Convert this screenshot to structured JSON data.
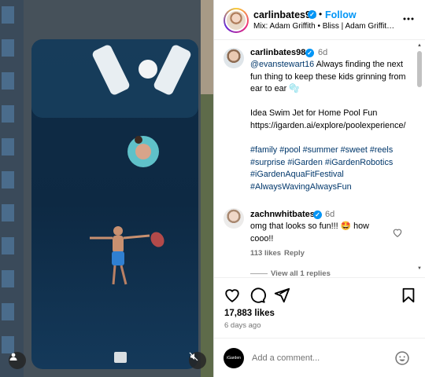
{
  "post": {
    "username": "carlinbates98",
    "follow_label": "Follow",
    "separator": "•",
    "audio": "Mix: Adam Griffith • Bliss | Adam Griffith ..."
  },
  "caption": {
    "username": "carlinbates98",
    "time": "6d",
    "mention": "@evanstewart16",
    "text_line1": " Always finding the next fun thing to keep these kids grinning from ear to ear 🫧",
    "text_line2": "Idea Swim Jet for Home Pool Fun",
    "link": "https://igarden.ai/explore/poolexperience/",
    "hashtags": "#family #pool #summer #sweet #reels #surprise #iGarden #iGardenRobotics #iGardenAquaFitFestival #AlwaysWavingAlwaysFun"
  },
  "comment": {
    "username": "zachnwhitbates",
    "time": "6d",
    "text": "omg that looks so fun!!! 🤩 how cooo!!",
    "likes": "113 likes",
    "reply_label": "Reply",
    "view_replies": "View all 1 replies"
  },
  "actions": {
    "likes": "17,883 likes",
    "date": "6 days ago"
  },
  "add_comment": {
    "placeholder": "Add a comment...",
    "avatar_text": "iGarden"
  },
  "icons": {
    "more": "more-horizontal-icon",
    "like": "heart-icon",
    "comment": "comment-icon",
    "share": "send-icon",
    "save": "bookmark-icon",
    "emoji": "emoji-icon",
    "user": "user-icon",
    "mute": "mute-icon"
  },
  "colors": {
    "accent": "#0095f6",
    "link": "#00376b",
    "muted": "#737373"
  }
}
